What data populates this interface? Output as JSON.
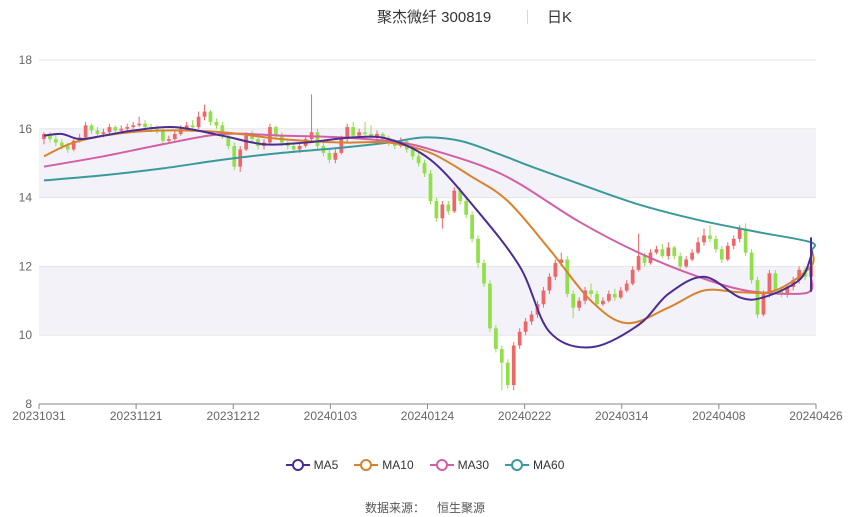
{
  "header": {
    "title": "聚杰微纤 300819",
    "period": "日K"
  },
  "source": {
    "label": "数据来源：",
    "value": "恒生聚源"
  },
  "colors": {
    "up": "#ee6666",
    "down": "#91e04a",
    "ma5": "#4b2c93",
    "ma10": "#d9822b",
    "ma30": "#d35fa6",
    "ma60": "#3a9a9a",
    "band": "#f2f2f8",
    "grid": "#e6e6e6",
    "axis": "#888888"
  },
  "chart_data": {
    "type": "candlestick",
    "x_ticks": [
      "20231031",
      "20231121",
      "20231212",
      "20240103",
      "20240124",
      "20240222",
      "20240314",
      "20240408",
      "20240426"
    ],
    "y_ticks": [
      8,
      10,
      12,
      14,
      16,
      18
    ],
    "ylim": [
      8,
      18
    ],
    "legend": [
      {
        "name": "MA5",
        "color": "#4b2c93"
      },
      {
        "name": "MA10",
        "color": "#d9822b"
      },
      {
        "name": "MA30",
        "color": "#d35fa6"
      },
      {
        "name": "MA60",
        "color": "#3a9a9a"
      }
    ],
    "candles": [
      [
        15.7,
        15.85,
        15.55,
        15.9
      ],
      [
        15.8,
        15.7,
        15.6,
        15.9
      ],
      [
        15.7,
        15.6,
        15.5,
        15.8
      ],
      [
        15.6,
        15.5,
        15.4,
        15.7
      ],
      [
        15.5,
        15.4,
        15.3,
        15.6
      ],
      [
        15.4,
        15.65,
        15.35,
        15.7
      ],
      [
        15.65,
        15.75,
        15.6,
        15.85
      ],
      [
        15.75,
        16.1,
        15.7,
        16.2
      ],
      [
        16.1,
        15.95,
        15.85,
        16.15
      ],
      [
        15.95,
        15.85,
        15.8,
        16.05
      ],
      [
        15.85,
        15.9,
        15.75,
        16
      ],
      [
        15.9,
        16.05,
        15.85,
        16.15
      ],
      [
        16.05,
        15.95,
        15.9,
        16.1
      ],
      [
        15.95,
        16,
        15.9,
        16.1
      ],
      [
        16,
        16.05,
        15.95,
        16.15
      ],
      [
        16.05,
        16.1,
        16,
        16.2
      ],
      [
        16.1,
        16.15,
        16.05,
        16.35
      ],
      [
        16.15,
        16.05,
        15.95,
        16.25
      ],
      [
        16.05,
        16,
        15.9,
        16.15
      ],
      [
        16,
        15.95,
        15.85,
        16.1
      ],
      [
        15.95,
        15.65,
        15.55,
        16
      ],
      [
        15.65,
        15.7,
        15.6,
        15.8
      ],
      [
        15.7,
        15.85,
        15.65,
        15.95
      ],
      [
        15.85,
        16,
        15.8,
        16.1
      ],
      [
        16,
        16.1,
        15.95,
        16.2
      ],
      [
        16.1,
        16.05,
        16,
        16.25
      ],
      [
        16.05,
        16.35,
        16,
        16.5
      ],
      [
        16.35,
        16.5,
        16.25,
        16.7
      ],
      [
        16.5,
        16.2,
        16.1,
        16.55
      ],
      [
        16.2,
        16.1,
        16,
        16.3
      ],
      [
        16.1,
        15.8,
        15.7,
        16.2
      ],
      [
        15.8,
        15.5,
        15.4,
        15.9
      ],
      [
        15.5,
        14.9,
        14.8,
        15.6
      ],
      [
        14.9,
        15.4,
        14.75,
        15.5
      ],
      [
        15.4,
        15.8,
        15.35,
        15.9
      ],
      [
        15.8,
        15.7,
        15.6,
        15.95
      ],
      [
        15.7,
        15.5,
        15.4,
        15.8
      ],
      [
        15.5,
        15.6,
        15.4,
        15.7
      ],
      [
        15.6,
        16.05,
        15.55,
        16.15
      ],
      [
        16.05,
        15.8,
        15.7,
        16.1
      ],
      [
        15.8,
        15.6,
        15.5,
        15.9
      ],
      [
        15.6,
        15.5,
        15.4,
        15.7
      ],
      [
        15.5,
        15.4,
        15.3,
        15.6
      ],
      [
        15.4,
        15.5,
        15.3,
        15.6
      ],
      [
        15.5,
        15.7,
        15.45,
        15.8
      ],
      [
        15.7,
        15.9,
        15.6,
        17
      ],
      [
        15.9,
        15.5,
        15.4,
        16
      ],
      [
        15.5,
        15.3,
        15.2,
        15.6
      ],
      [
        15.3,
        15.1,
        15,
        15.4
      ],
      [
        15.1,
        15.3,
        15,
        15.4
      ],
      [
        15.3,
        15.7,
        15.25,
        15.8
      ],
      [
        15.7,
        16.05,
        15.6,
        16.15
      ],
      [
        16.05,
        15.8,
        15.7,
        16.2
      ],
      [
        15.8,
        15.9,
        15.7,
        16
      ],
      [
        15.9,
        15.85,
        15.8,
        16.2
      ],
      [
        15.85,
        15.75,
        15.7,
        16.1
      ],
      [
        15.75,
        15.85,
        15.7,
        15.95
      ],
      [
        15.85,
        15.7,
        15.6,
        15.9
      ],
      [
        15.7,
        15.6,
        15.5,
        15.8
      ],
      [
        15.6,
        15.5,
        15.4,
        15.7
      ],
      [
        15.5,
        15.65,
        15.45,
        15.75
      ],
      [
        15.65,
        15.4,
        15.3,
        15.7
      ],
      [
        15.4,
        15.2,
        15.1,
        15.5
      ],
      [
        15.2,
        15,
        14.9,
        15.3
      ],
      [
        15,
        14.7,
        14.6,
        15.1
      ],
      [
        14.7,
        13.9,
        13.8,
        14.8
      ],
      [
        13.9,
        13.4,
        13.3,
        14
      ],
      [
        13.4,
        13.8,
        13.1,
        13.9
      ],
      [
        13.8,
        13.6,
        13.5,
        13.9
      ],
      [
        13.6,
        14.2,
        13.55,
        14.3
      ],
      [
        14.2,
        13.9,
        13.8,
        14.3
      ],
      [
        13.9,
        13.5,
        13.4,
        14
      ],
      [
        13.5,
        12.8,
        12.7,
        13.6
      ],
      [
        12.8,
        12.1,
        11.95,
        12.9
      ],
      [
        12.1,
        11.5,
        11.4,
        12.2
      ],
      [
        11.5,
        10.2,
        10.1,
        11.6
      ],
      [
        10.2,
        9.6,
        9.5,
        10.3
      ],
      [
        9.6,
        9.2,
        8.4,
        9.7
      ],
      [
        9.2,
        8.55,
        8.45,
        9.3
      ],
      [
        8.55,
        9.7,
        8.4,
        9.8
      ],
      [
        9.7,
        10.1,
        9.6,
        10.2
      ],
      [
        10.1,
        10.4,
        10,
        10.5
      ],
      [
        10.4,
        10.6,
        10.3,
        10.7
      ],
      [
        10.6,
        10.9,
        10.5,
        11
      ],
      [
        10.9,
        11.3,
        10.8,
        11.4
      ],
      [
        11.3,
        11.7,
        11.2,
        11.8
      ],
      [
        11.7,
        12.1,
        11.6,
        12.2
      ],
      [
        12.1,
        12.2,
        12,
        12.4
      ],
      [
        12.2,
        11.2,
        11.1,
        12.3
      ],
      [
        11.2,
        10.8,
        10.5,
        11.3
      ],
      [
        10.8,
        11,
        10.7,
        11.1
      ],
      [
        11,
        11.3,
        10.9,
        11.4
      ],
      [
        11.3,
        11.2,
        11.1,
        11.5
      ],
      [
        11.2,
        10.9,
        10.8,
        11.3
      ],
      [
        10.9,
        11,
        10.85,
        11.1
      ],
      [
        11,
        11.2,
        10.95,
        11.3
      ],
      [
        11.2,
        11.1,
        11,
        11.35
      ],
      [
        11.1,
        11.3,
        11.05,
        11.4
      ],
      [
        11.3,
        11.5,
        11.25,
        11.6
      ],
      [
        11.5,
        11.9,
        11.45,
        12
      ],
      [
        11.9,
        12.3,
        11.85,
        12.95
      ],
      [
        12.3,
        12.1,
        12,
        12.4
      ],
      [
        12.1,
        12.4,
        12.05,
        12.5
      ],
      [
        12.4,
        12.5,
        12.35,
        12.6
      ],
      [
        12.5,
        12.3,
        12.25,
        12.65
      ],
      [
        12.3,
        12.55,
        12.2,
        12.7
      ],
      [
        12.55,
        12.3,
        12.2,
        12.6
      ],
      [
        12.3,
        12,
        11.9,
        12.4
      ],
      [
        12,
        12.2,
        11.95,
        12.3
      ],
      [
        12.2,
        12.4,
        12.15,
        12.5
      ],
      [
        12.4,
        12.7,
        12.35,
        12.85
      ],
      [
        12.7,
        12.9,
        12.6,
        13.1
      ],
      [
        12.9,
        12.8,
        12.7,
        13.2
      ],
      [
        12.8,
        12.5,
        12.4,
        12.9
      ],
      [
        12.5,
        12.2,
        12.1,
        12.6
      ],
      [
        12.2,
        12.6,
        12.15,
        12.7
      ],
      [
        12.6,
        12.8,
        12.5,
        12.9
      ],
      [
        12.8,
        13.1,
        12.7,
        13.2
      ],
      [
        13.1,
        12.4,
        12.3,
        13.25
      ],
      [
        12.4,
        11.6,
        11.5,
        12.5
      ],
      [
        11.6,
        10.6,
        10.5,
        11.7
      ],
      [
        10.6,
        11.2,
        10.55,
        11.3
      ],
      [
        11.2,
        11.8,
        11.1,
        11.9
      ],
      [
        11.8,
        11.3,
        11.2,
        11.9
      ],
      [
        11.3,
        11.2,
        11.1,
        11.4
      ],
      [
        11.2,
        11.4,
        11.1,
        11.5
      ],
      [
        11.4,
        11.6,
        11.3,
        11.7
      ],
      [
        11.6,
        11.9,
        11.5,
        12
      ],
      [
        11.9,
        11.7,
        11.6,
        12
      ],
      [
        11.7,
        12,
        11.65,
        12.1
      ]
    ],
    "ma5": [
      [
        0,
        15.8
      ],
      [
        3,
        15.85
      ],
      [
        6,
        15.7
      ],
      [
        10,
        15.8
      ],
      [
        15,
        15.95
      ],
      [
        22,
        16.05
      ],
      [
        30,
        15.8
      ],
      [
        37,
        15.55
      ],
      [
        44,
        15.6
      ],
      [
        52,
        15.75
      ],
      [
        58,
        15.7
      ],
      [
        65,
        15.1
      ],
      [
        72,
        13.8
      ],
      [
        80,
        12.0
      ],
      [
        85,
        10.1
      ],
      [
        92,
        9.65
      ],
      [
        100,
        10.3
      ],
      [
        105,
        11.2
      ],
      [
        111,
        11.7
      ],
      [
        117,
        11.1
      ],
      [
        121,
        11.1
      ],
      [
        127,
        11.6
      ],
      [
        133,
        12.3
      ],
      [
        139,
        12.5
      ],
      [
        145,
        12.3
      ],
      [
        151,
        12.8
      ],
      [
        157,
        12.6
      ],
      [
        163,
        11.5
      ],
      [
        167,
        11.3
      ],
      [
        172,
        11.7
      ]
    ],
    "ma10": [
      [
        0,
        15.2
      ],
      [
        5,
        15.6
      ],
      [
        12,
        15.85
      ],
      [
        20,
        15.95
      ],
      [
        30,
        15.9
      ],
      [
        40,
        15.7
      ],
      [
        50,
        15.6
      ],
      [
        58,
        15.6
      ],
      [
        65,
        15.3
      ],
      [
        72,
        14.6
      ],
      [
        78,
        13.9
      ],
      [
        85,
        12.5
      ],
      [
        92,
        11.0
      ],
      [
        98,
        10.35
      ],
      [
        105,
        10.8
      ],
      [
        111,
        11.3
      ],
      [
        117,
        11.25
      ],
      [
        123,
        11.3
      ],
      [
        130,
        12.0
      ],
      [
        137,
        12.5
      ],
      [
        144,
        12.4
      ],
      [
        151,
        12.6
      ],
      [
        157,
        12.55
      ],
      [
        163,
        12.2
      ],
      [
        168,
        11.85
      ],
      [
        172,
        11.6
      ]
    ],
    "ma30": [
      [
        0,
        14.9
      ],
      [
        10,
        15.2
      ],
      [
        20,
        15.55
      ],
      [
        30,
        15.85
      ],
      [
        40,
        15.8
      ],
      [
        50,
        15.75
      ],
      [
        60,
        15.6
      ],
      [
        66,
        15.35
      ],
      [
        74,
        14.9
      ],
      [
        80,
        14.4
      ],
      [
        90,
        13.3
      ],
      [
        100,
        12.4
      ],
      [
        110,
        11.7
      ],
      [
        118,
        11.3
      ],
      [
        126,
        11.2
      ],
      [
        132,
        11.3
      ],
      [
        140,
        11.7
      ],
      [
        146,
        11.9
      ],
      [
        152,
        12.0
      ],
      [
        158,
        12.05
      ],
      [
        164,
        12.1
      ],
      [
        172,
        12.2
      ]
    ],
    "ma60": [
      [
        0,
        14.5
      ],
      [
        10,
        14.65
      ],
      [
        20,
        14.85
      ],
      [
        30,
        15.1
      ],
      [
        40,
        15.3
      ],
      [
        50,
        15.45
      ],
      [
        58,
        15.6
      ],
      [
        64,
        15.75
      ],
      [
        70,
        15.65
      ],
      [
        76,
        15.3
      ],
      [
        82,
        14.9
      ],
      [
        90,
        14.4
      ],
      [
        100,
        13.8
      ],
      [
        110,
        13.35
      ],
      [
        120,
        13.0
      ],
      [
        130,
        12.7
      ],
      [
        140,
        12.45
      ],
      [
        150,
        12.3
      ],
      [
        160,
        12.0
      ],
      [
        166,
        11.9
      ],
      [
        172,
        11.8
      ]
    ]
  }
}
